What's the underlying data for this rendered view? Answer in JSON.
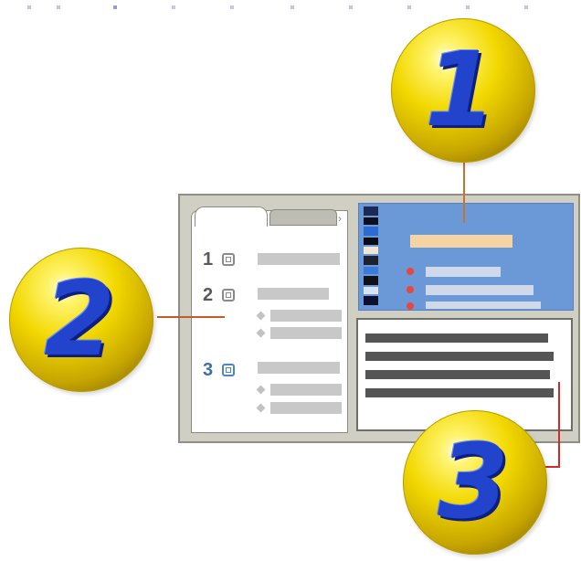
{
  "callouts": [
    {
      "number": "1",
      "target": "top-right-panel"
    },
    {
      "number": "2",
      "target": "left-panel"
    },
    {
      "number": "3",
      "target": "bottom-right-panel"
    }
  ],
  "left_panel": {
    "rows": [
      {
        "number": "1",
        "sub_items": 0
      },
      {
        "number": "2",
        "sub_items": 2
      },
      {
        "number": "3",
        "sub_items": 2
      }
    ]
  },
  "colors": {
    "ball": "#f2d800",
    "digit": "#2244cc",
    "callout_line_1": "#c5752a",
    "callout_line_2": "#c55a2a",
    "callout_line_3": "#d22a2a",
    "top_right_bg": "#6b98d6",
    "orange_bar": "#f6d3a3",
    "bullet": "#e8463f"
  },
  "icons": [
    "folder-tab-icon",
    "checkbox-icon",
    "diamond-bullet-icon",
    "film-strip-icon"
  ]
}
